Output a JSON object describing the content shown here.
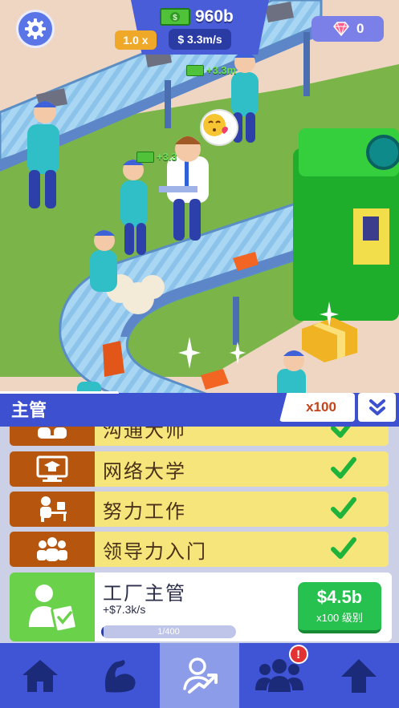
{
  "hud": {
    "cash": "960b",
    "multiplier": "1.0 x",
    "rate": "$ 3.3m/s",
    "gems": "0",
    "float_income_1": "+3.3m",
    "float_income_2": "+3.3"
  },
  "panel": {
    "title": "主管",
    "buy_amount": "x100"
  },
  "skills": [
    {
      "label": "沟通大师",
      "icon": "meeting-icon",
      "unlocked": true
    },
    {
      "label": "网络大学",
      "icon": "online-course-icon",
      "unlocked": true
    },
    {
      "label": "努力工作",
      "icon": "desk-worker-icon",
      "unlocked": true
    },
    {
      "label": "领导力入门",
      "icon": "team-icon",
      "unlocked": true
    }
  ],
  "manager": {
    "name": "工厂主管",
    "income": "+$7.3k/s",
    "progress_label": "1/400",
    "progress": 0.0025,
    "price": "$4.5b",
    "price_sub": "x100 级别"
  },
  "nav": {
    "tabs": [
      "home-icon",
      "muscle-icon",
      "manager-icon",
      "staff-icon",
      "upgrade-arrow-icon"
    ],
    "active": 2,
    "notification": "!"
  },
  "colors": {
    "primary": "#3f55d6",
    "skill_bg": "#f6e57a",
    "skill_icon_bg": "#b6550e",
    "buy_green": "#27c14f",
    "check_green": "#1eb33a"
  }
}
